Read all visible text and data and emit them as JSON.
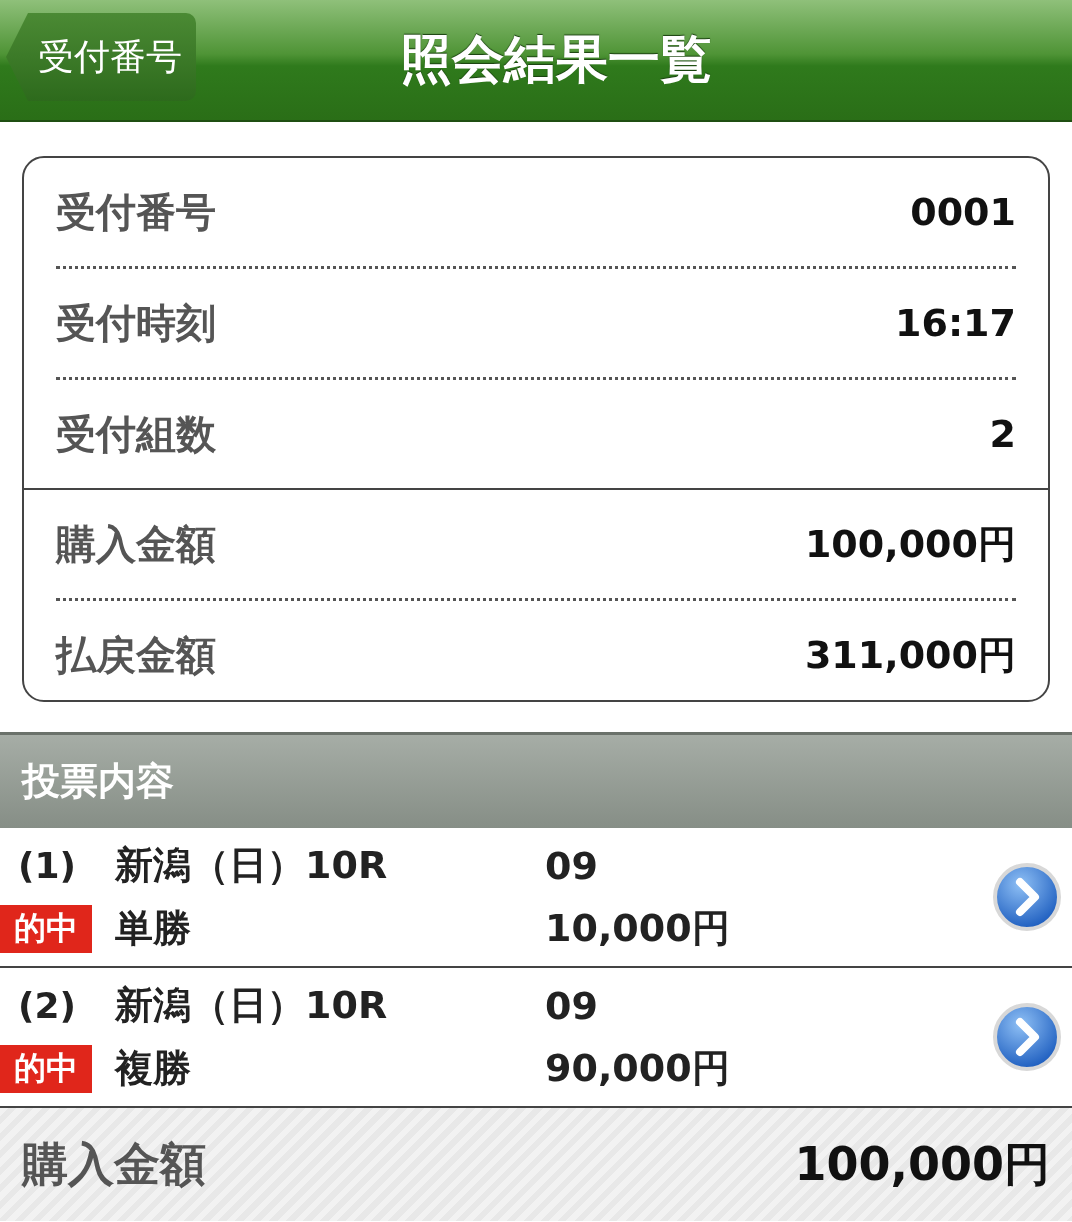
{
  "header": {
    "back_button": "受付番号",
    "title": "照会結果一覧"
  },
  "summary": {
    "groups": [
      {
        "rows": [
          {
            "label": "受付番号",
            "value": "0001"
          },
          {
            "label": "受付時刻",
            "value": "16:17"
          },
          {
            "label": "受付組数",
            "value": "2"
          }
        ]
      },
      {
        "rows": [
          {
            "label": "購入金額",
            "value": "100,000円"
          },
          {
            "label": "払戻金額",
            "value": "311,000円"
          }
        ]
      }
    ]
  },
  "section_title": "投票内容",
  "bets": [
    {
      "index": "(1)",
      "badge": "的中",
      "venue": "新潟（日）10R",
      "bet_type": "単勝",
      "horse": "09",
      "amount": "10,000円"
    },
    {
      "index": "(2)",
      "badge": "的中",
      "venue": "新潟（日）10R",
      "bet_type": "複勝",
      "horse": "09",
      "amount": "90,000円"
    }
  ],
  "footer": {
    "label": "購入金額",
    "value": "100,000円"
  }
}
